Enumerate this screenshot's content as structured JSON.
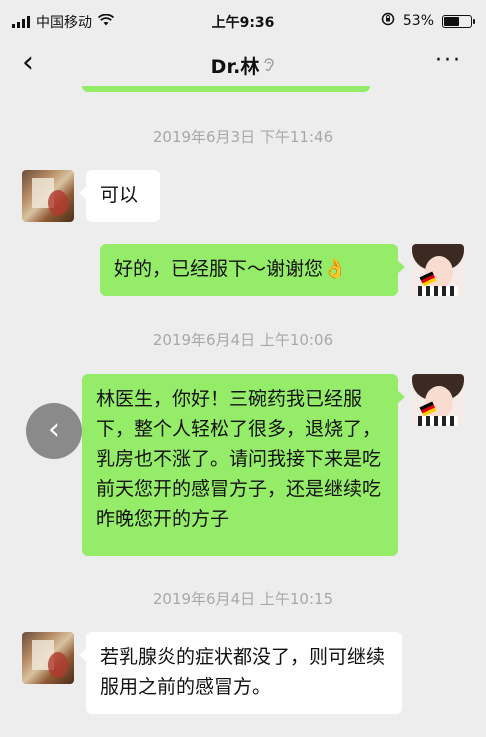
{
  "status": {
    "carrier": "中国移动",
    "time": "上午9:36",
    "battery": "53%",
    "battery_level": 0.53
  },
  "nav": {
    "back": "‹",
    "title": "Dr.林",
    "ear_icon": "ear-icon",
    "more": "···"
  },
  "messages": [
    {
      "timestamp": "2019年6月3日 下午11:46"
    },
    {
      "sender": "doctor",
      "text": "可以"
    },
    {
      "sender": "user",
      "text": "好的，已经服下～谢谢您👌"
    },
    {
      "timestamp": "2019年6月4日 上午10:06"
    },
    {
      "sender": "user",
      "text": "林医生，你好！三碗药我已经服下，整个人轻松了很多，退烧了，乳房也不涨了。请问我接下来是吃前天您开的感冒方子，还是继续吃昨晚您开的方子"
    },
    {
      "timestamp": "2019年6月4日 上午10:15"
    },
    {
      "sender": "doctor",
      "text": "若乳腺炎的症状都没了，则可继续服用之前的感冒方。"
    }
  ],
  "float_back": "‹"
}
